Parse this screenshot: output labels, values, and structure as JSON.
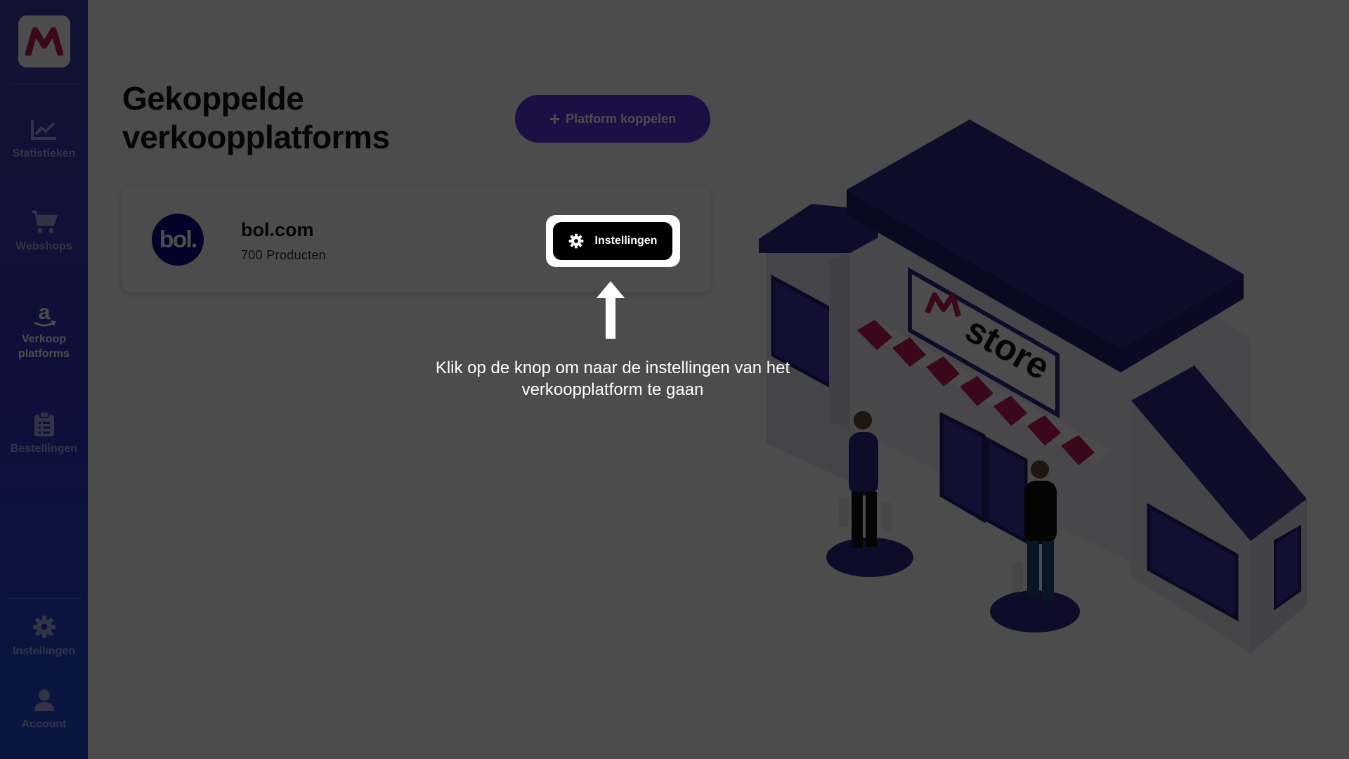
{
  "sidebar": {
    "logo_text": "M",
    "items": [
      {
        "label": "Statistieken",
        "icon": "chart-icon"
      },
      {
        "label": "Webshops",
        "icon": "cart-icon"
      },
      {
        "label": "Verkoop platforms",
        "icon": "amazon-icon"
      },
      {
        "label": "Bestellingen",
        "icon": "clipboard-icon"
      },
      {
        "label": "Instellingen",
        "icon": "gear-icon"
      },
      {
        "label": "Account",
        "icon": "user-icon"
      }
    ]
  },
  "main": {
    "title": "Gekoppelde verkoopplatforms",
    "add_button": {
      "plus": "+",
      "label": "Platform koppelen"
    }
  },
  "platform": {
    "logo_text": "bol.",
    "name": "bol.com",
    "subtitle": "700 Producten",
    "settings_label": "Instellingen"
  },
  "tutorial": {
    "hint": "Klik op de knop om naar de instellingen van het verkoopplatform te gaan"
  },
  "illustration": {
    "sign_letter": "M",
    "sign_text": "store"
  },
  "colors": {
    "accent": "#5b33e6",
    "sidebar": "#2f35c4",
    "bol": "#0a0a8c",
    "brand": "#c2185b"
  }
}
